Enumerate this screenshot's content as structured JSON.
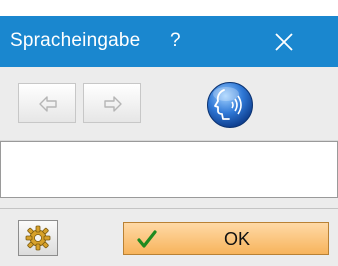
{
  "window": {
    "title": "Spracheingabe",
    "help_label": "?",
    "close_icon": "close-icon",
    "accent": "#1a87cf"
  },
  "toolbar": {
    "back_icon": "arrow-left-icon",
    "forward_icon": "arrow-right-icon",
    "speech_icon": "speech-head-icon"
  },
  "input": {
    "value": ""
  },
  "footer": {
    "settings_icon": "settings-gear-icon",
    "ok_label": "OK",
    "ok_icon": "checkmark-icon",
    "ok_color": "#f7b45c"
  }
}
